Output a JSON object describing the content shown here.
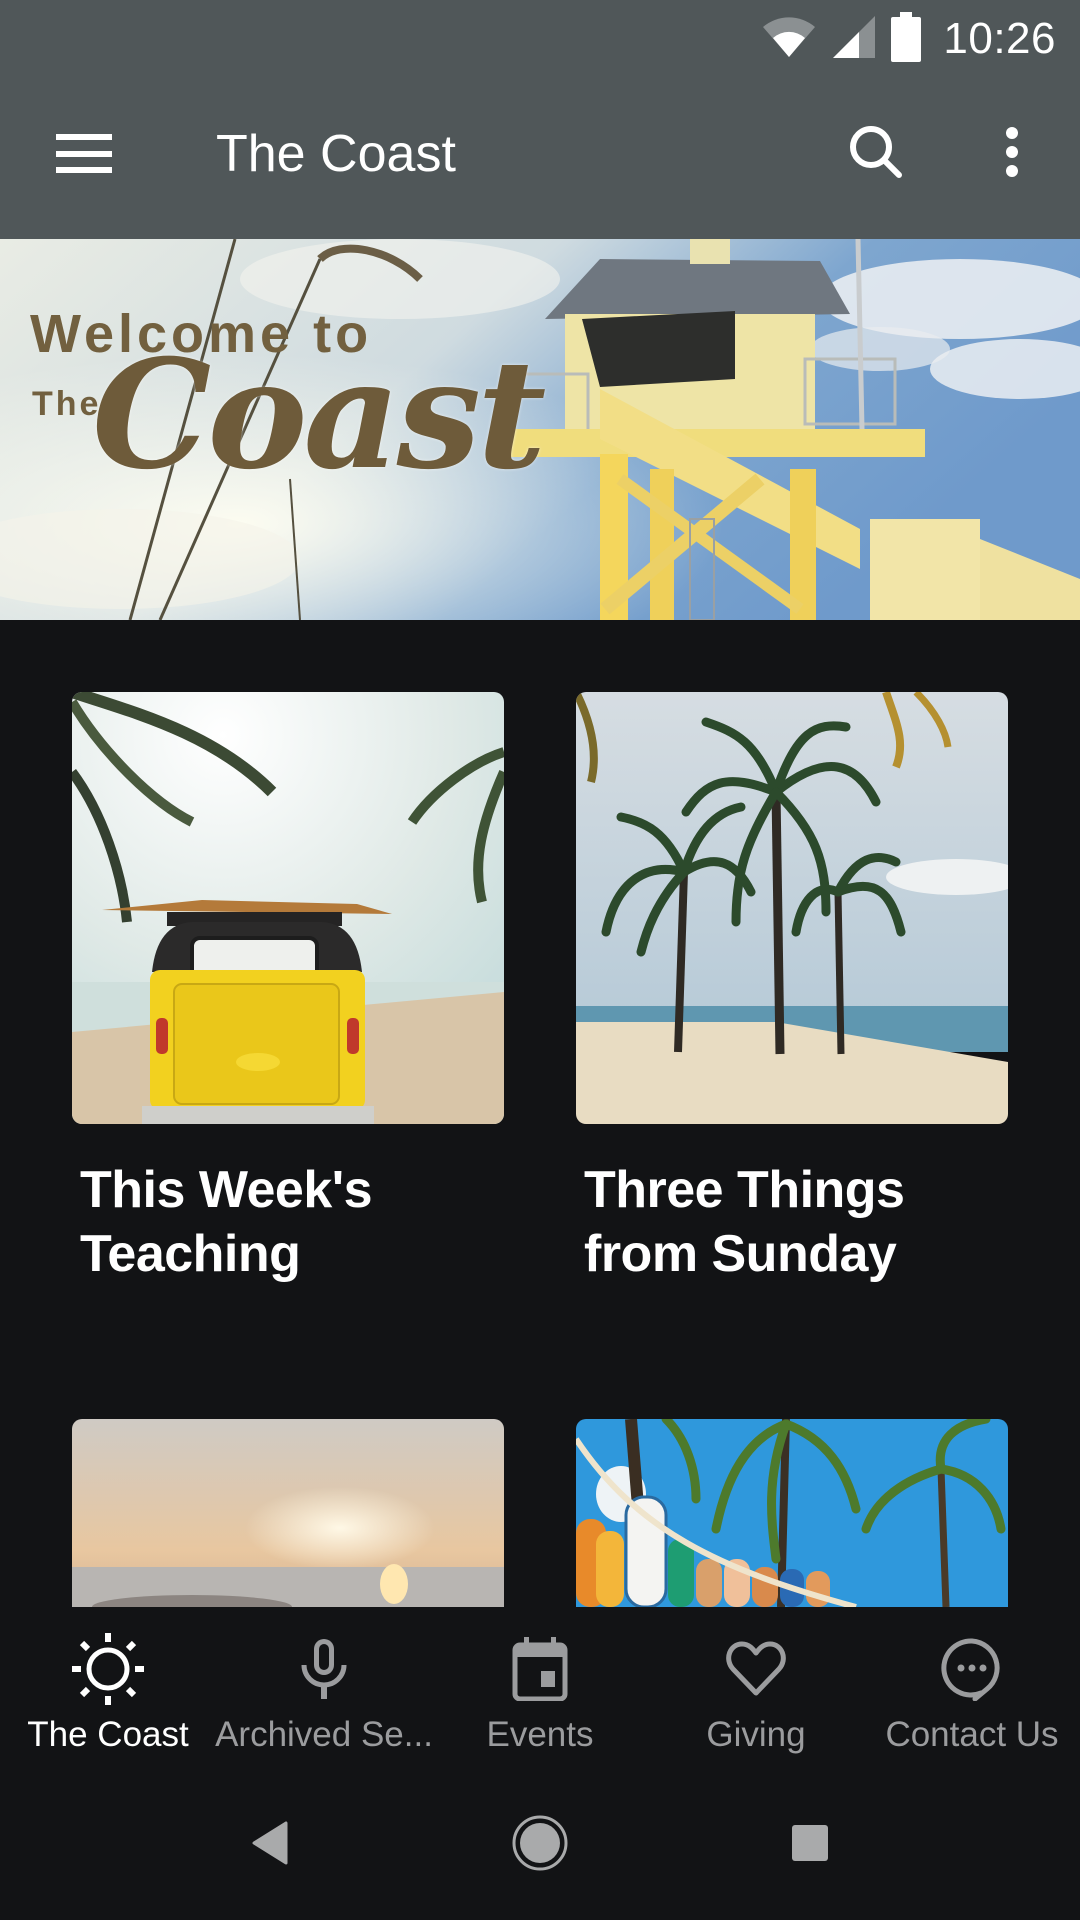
{
  "status_bar": {
    "time": "10:26",
    "icons": [
      "wifi-icon",
      "cellular-signal-icon",
      "battery-icon"
    ]
  },
  "app_bar": {
    "title": "The Coast",
    "menu_icon": "hamburger-menu-icon",
    "search_icon": "search-icon",
    "more_icon": "more-vertical-icon"
  },
  "banner": {
    "line1": "Welcome to",
    "line2": "The",
    "line3": "Coast",
    "image_description": "yellow lifeguard tower against cloudy sky with sea oats"
  },
  "cards": [
    {
      "title": "This Week's Teaching",
      "image_description": "yellow van with surfboard on beach with palm trees"
    },
    {
      "title": "Three Things from Sunday",
      "image_description": "three palm trees on sandy beach by the sea"
    },
    {
      "title": "",
      "image_description": "blurred sunset over the water"
    },
    {
      "title": "",
      "image_description": "surfboards in racks under palm trees and blue sky"
    }
  ],
  "tabs": [
    {
      "label": "The Coast",
      "icon": "sun-icon",
      "active": true
    },
    {
      "label": "Archived Se...",
      "icon": "microphone-icon",
      "active": false
    },
    {
      "label": "Events",
      "icon": "calendar-icon",
      "active": false
    },
    {
      "label": "Giving",
      "icon": "heart-icon",
      "active": false
    },
    {
      "label": "Contact Us",
      "icon": "chat-bubble-icon",
      "active": false
    }
  ],
  "system_nav": [
    "back-icon",
    "home-icon",
    "recents-icon"
  ],
  "colors": {
    "app_bar": "#505759",
    "background": "#121315",
    "tab_active": "#ffffff",
    "tab_inactive": "#9b9c9e",
    "banner_text": "#72603f"
  }
}
